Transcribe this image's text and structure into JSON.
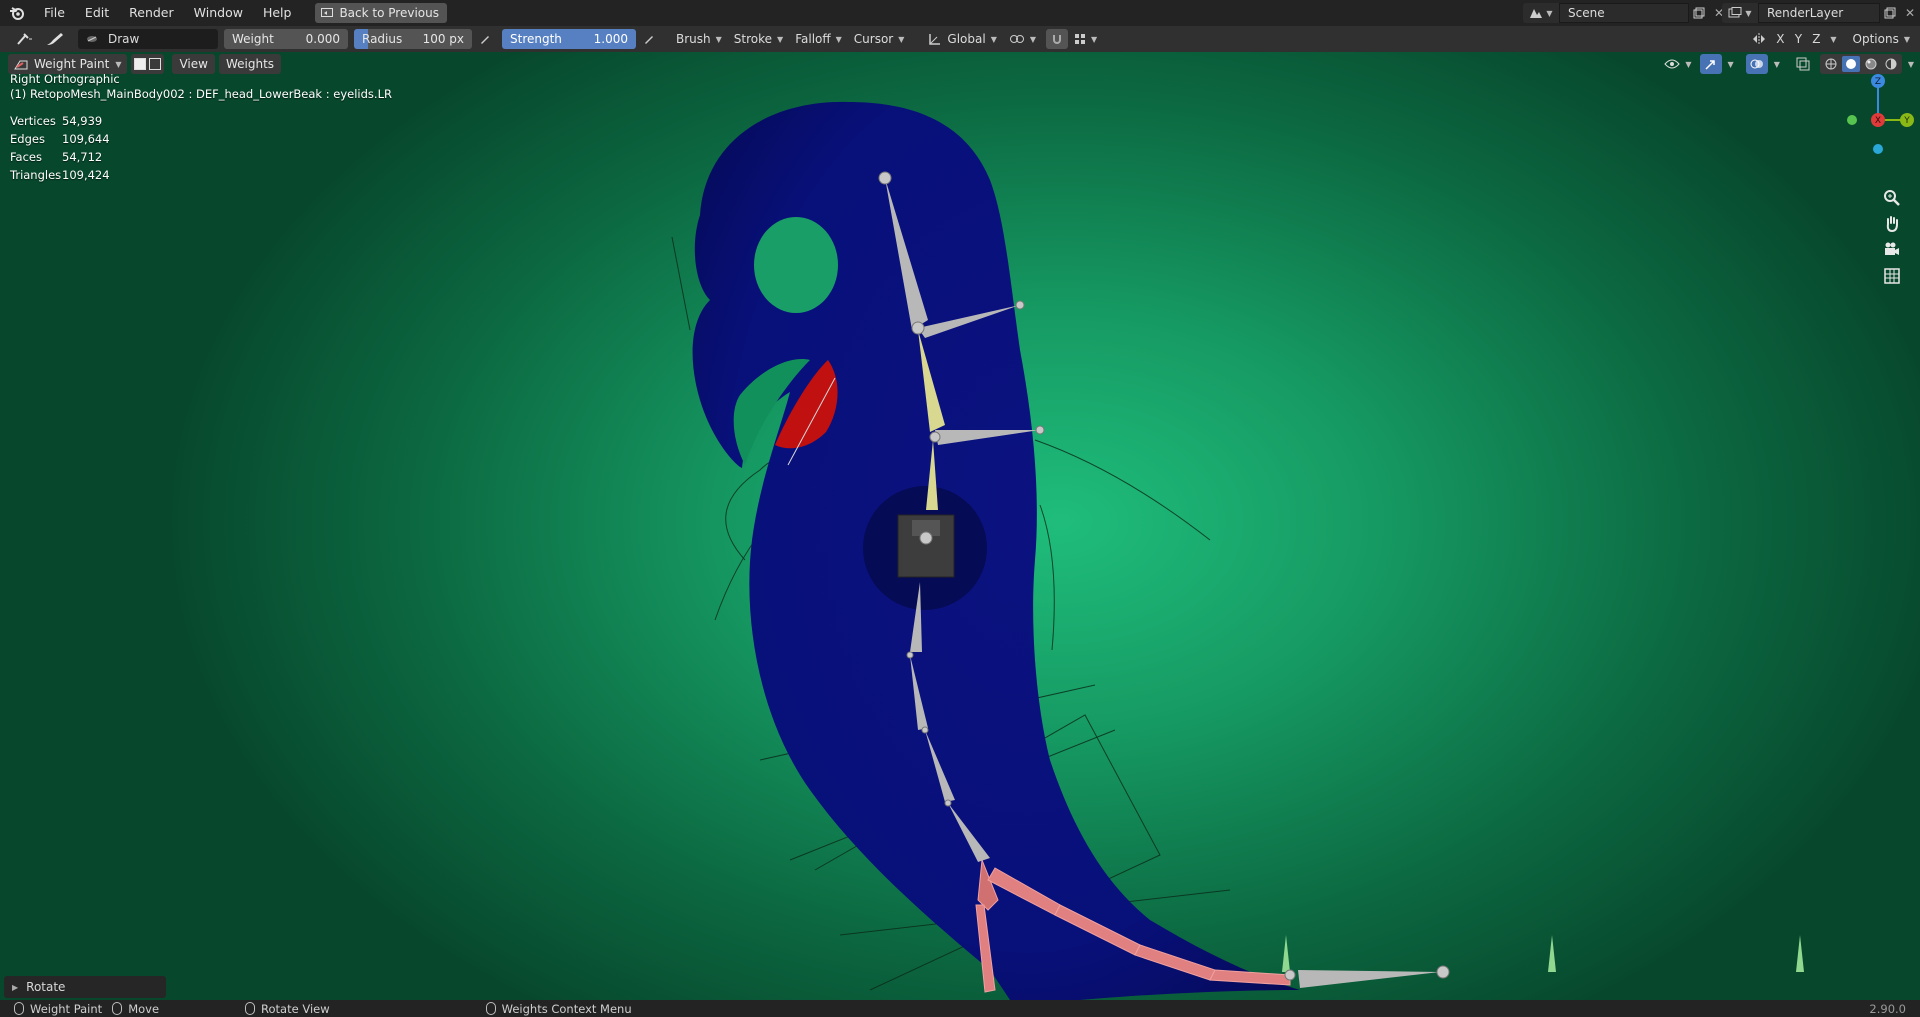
{
  "topbar": {
    "menus": [
      "File",
      "Edit",
      "Render",
      "Window",
      "Help"
    ],
    "back_button": "Back to Previous",
    "scene_name": "Scene",
    "render_layer": "RenderLayer"
  },
  "toolheader": {
    "brush_name": "Draw",
    "weight_label": "Weight",
    "weight_value": "0.000",
    "radius_label": "Radius",
    "radius_value": "100 px",
    "strength_label": "Strength",
    "strength_value": "1.000",
    "dropdowns": [
      "Brush",
      "Stroke",
      "Falloff",
      "Cursor"
    ],
    "orientation": "Global",
    "axes": [
      "X",
      "Y",
      "Z"
    ],
    "options": "Options"
  },
  "viewport": {
    "mode": "Weight Paint",
    "menus": [
      "View",
      "Weights"
    ],
    "view_name": "Right Orthographic",
    "object_info": "(1) RetopoMesh_MainBody002 : DEF_head_LowerBeak : eyelids.LR",
    "stats": [
      {
        "label": "Vertices",
        "value": "54,939"
      },
      {
        "label": "Edges",
        "value": "109,644"
      },
      {
        "label": "Faces",
        "value": "54,712"
      },
      {
        "label": "Triangles",
        "value": "109,424"
      }
    ],
    "gizmo": {
      "z": "Z",
      "x": "X",
      "y": "Y"
    },
    "rotate_panel": "Rotate"
  },
  "statusbar": {
    "items": [
      "Weight Paint",
      "Move",
      "Rotate View",
      "Weights Context Menu"
    ],
    "version": "2.90.0"
  },
  "colors": {
    "mesh": "#0a0f7a",
    "accent_blue": "#5680c2",
    "bone_gray": "#b8b8b8",
    "bone_selected": "#d8d890",
    "bone_red": "#e08080"
  }
}
